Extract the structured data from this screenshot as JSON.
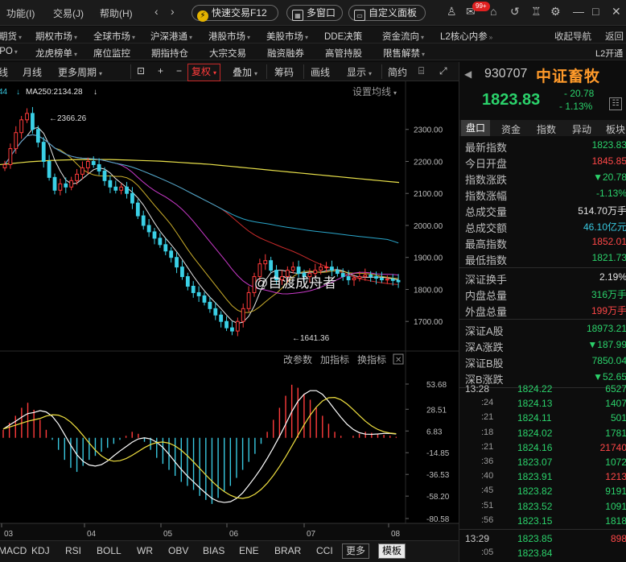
{
  "menubar": {
    "items": [
      "功能(I)",
      "交易(J)",
      "帮助(H)"
    ],
    "quick_trade": "快速交易F12",
    "multi_window": "多窗口",
    "custom_panel": "自定义面板",
    "badge": "99+"
  },
  "nav1": {
    "items": [
      "期货",
      "期权市场",
      "全球市场",
      "沪深港通",
      "港股市场",
      "美股市场",
      "DDE决策",
      "资金流向",
      "L2核心内参"
    ],
    "right": [
      "收起导航",
      "返回"
    ]
  },
  "nav2": {
    "items": [
      "IPO",
      "龙虎榜单",
      "席位监控",
      "期指持仓",
      "大宗交易",
      "融资融券",
      "高管持股",
      "限售解禁"
    ],
    "right": "L2开通"
  },
  "toolbar": {
    "items": [
      "线",
      "月线",
      "更多周期",
      "复权",
      "叠加",
      "筹码",
      "画线",
      "显示",
      "简约"
    ]
  },
  "chart": {
    "ma_legend_prefix": "44",
    "ma_legend": "MA250:2134.28",
    "settings": "设置均线",
    "high_label": "2366.26",
    "low_label": "1641.36",
    "watermark": "@自渡成舟者",
    "indicator_actions": [
      "改参数",
      "加指标",
      "换指标"
    ],
    "x_labels": [
      "03",
      "04",
      "05",
      "06",
      "07",
      "08"
    ]
  },
  "chart_data": {
    "type": "candlestick",
    "price_ticks": [
      2300.0,
      2200.0,
      2100.0,
      2000.0,
      1900.0,
      1800.0,
      1700.0
    ],
    "price_tick_labels": [
      "2300.00",
      "2200.00",
      "2100.00",
      "2000.00",
      "1900.00",
      "1800.00",
      "1700.00"
    ],
    "high": 2366.26,
    "low": 1641.36,
    "macd_ticks": [
      53.68,
      28.51,
      6.83,
      -14.85,
      -36.53,
      -58.2,
      -80.58
    ],
    "macd_tick_labels": [
      "53.68",
      "28.51",
      "6.83",
      "-14.85",
      "-36.53",
      "-58.20",
      "-80.58"
    ],
    "closes": [
      2190,
      2240,
      2290,
      2330,
      2350,
      2300,
      2260,
      2200,
      2150,
      2110,
      2130,
      2120,
      2140,
      2160,
      2180,
      2200,
      2190,
      2170,
      2140,
      2120,
      2110,
      2120,
      2100,
      2070,
      2030,
      2000,
      1980,
      1960,
      1940,
      1920,
      1900,
      1870,
      1840,
      1810,
      1790,
      1780,
      1760,
      1740,
      1720,
      1700,
      1680,
      1670,
      1700,
      1740,
      1790,
      1840,
      1880,
      1890,
      1860,
      1830,
      1840,
      1860,
      1870,
      1850,
      1840,
      1850,
      1860,
      1870,
      1870,
      1860,
      1850,
      1840,
      1830,
      1835,
      1840,
      1845,
      1840,
      1835,
      1830,
      1832,
      1828,
      1823.83
    ],
    "ma250": [
      2190,
      2193,
      2196,
      2199,
      2201,
      2203,
      2204,
      2205,
      2206,
      2206,
      2206,
      2206,
      2205,
      2204,
      2203,
      2202,
      2201,
      2199,
      2197,
      2195,
      2193,
      2191,
      2188,
      2185,
      2182,
      2179,
      2176,
      2173,
      2170,
      2167,
      2164,
      2161,
      2158,
      2155,
      2152,
      2149,
      2146,
      2143,
      2140,
      2137,
      2134.28
    ],
    "macd_hist": [
      8,
      15,
      22,
      30,
      35,
      28,
      18,
      8,
      -2,
      -12,
      -22,
      -30,
      -34,
      -28,
      -22,
      -18,
      -14,
      -10,
      -6,
      -2,
      2,
      6,
      4,
      -4,
      -12,
      -20,
      -26,
      -32,
      -38,
      -44,
      -48,
      -52,
      -58,
      -62,
      -66,
      -60,
      -54,
      -48,
      -40,
      -32,
      -24,
      -16,
      -6,
      6,
      18,
      30,
      42,
      53,
      50,
      44,
      38,
      30,
      22,
      14,
      6,
      2,
      0,
      2,
      4,
      6,
      5,
      4,
      3,
      2,
      1
    ]
  },
  "indicators": {
    "tabs": [
      "MACD",
      "KDJ",
      "RSI",
      "BOLL",
      "WR",
      "OBV",
      "BIAS",
      "ENE",
      "BRAR",
      "CCI"
    ],
    "more": "更多",
    "template": "模板"
  },
  "quote": {
    "code": "930707",
    "name": "中证畜牧",
    "price": "1823.83",
    "change": "- 20.78",
    "pct": "- 1.13%"
  },
  "panel_tabs": [
    "盘口",
    "资金",
    "指数",
    "异动",
    "板块"
  ],
  "stats": [
    {
      "label": "最新指数",
      "value": "1823.83",
      "color": "#2bd26b"
    },
    {
      "label": "今日开盘",
      "value": "1845.85",
      "color": "#ff4747"
    },
    {
      "label": "指数涨跌",
      "value": "▼20.78",
      "color": "#2bd26b"
    },
    {
      "label": "指数涨幅",
      "value": "-1.13%",
      "color": "#2bd26b"
    },
    {
      "label": "总成交量",
      "value": "514.70万手",
      "color": "#e6e6e6"
    },
    {
      "label": "总成交额",
      "value": "46.10亿元",
      "color": "#38c8e0"
    },
    {
      "label": "最高指数",
      "value": "1852.01",
      "color": "#ff4747"
    },
    {
      "label": "最低指数",
      "value": "1821.73",
      "color": "#2bd26b"
    },
    {
      "label": "深证换手",
      "value": "2.19%",
      "color": "#e6e6e6"
    },
    {
      "label": "内盘总量",
      "value": "316万手",
      "color": "#2bd26b"
    },
    {
      "label": "外盘总量",
      "value": "199万手",
      "color": "#ff4747"
    },
    {
      "label": "深证A股",
      "value": "18973.21",
      "color": "#2bd26b"
    },
    {
      "label": "深A涨跌",
      "value": "▼187.99",
      "color": "#2bd26b"
    },
    {
      "label": "深证B股",
      "value": "7850.04",
      "color": "#2bd26b"
    },
    {
      "label": "深B涨跌",
      "value": "▼52.65",
      "color": "#2bd26b"
    }
  ],
  "ticks": [
    {
      "time": "13:28",
      "price": "1824.22",
      "vol": "6527",
      "color": "#2bd26b",
      "sub": false
    },
    {
      "time": ":24",
      "price": "1824.13",
      "vol": "1407",
      "color": "#2bd26b",
      "sub": true
    },
    {
      "time": ":21",
      "price": "1824.11",
      "vol": "501",
      "color": "#2bd26b",
      "sub": true
    },
    {
      "time": ":18",
      "price": "1824.02",
      "vol": "1781",
      "color": "#2bd26b",
      "sub": true
    },
    {
      "time": ":21",
      "price": "1824.16",
      "vol": "21740",
      "color": "#ff4747",
      "sub": true
    },
    {
      "time": ":36",
      "price": "1823.07",
      "vol": "1072",
      "color": "#2bd26b",
      "sub": true
    },
    {
      "time": ":40",
      "price": "1823.91",
      "vol": "1213",
      "color": "#ff4747",
      "sub": true
    },
    {
      "time": ":45",
      "price": "1823.82",
      "vol": "9191",
      "color": "#2bd26b",
      "sub": true
    },
    {
      "time": ":51",
      "price": "1823.52",
      "vol": "1091",
      "color": "#2bd26b",
      "sub": true
    },
    {
      "time": ":56",
      "price": "1823.15",
      "vol": "1818",
      "color": "#2bd26b",
      "sub": true
    },
    {
      "time": "13:29",
      "price": "1823.85",
      "vol": "898",
      "color": "#ff4747",
      "sub": false
    },
    {
      "time": ":05",
      "price": "1823.84",
      "vol": "",
      "color": "#2bd26b",
      "sub": true
    }
  ]
}
